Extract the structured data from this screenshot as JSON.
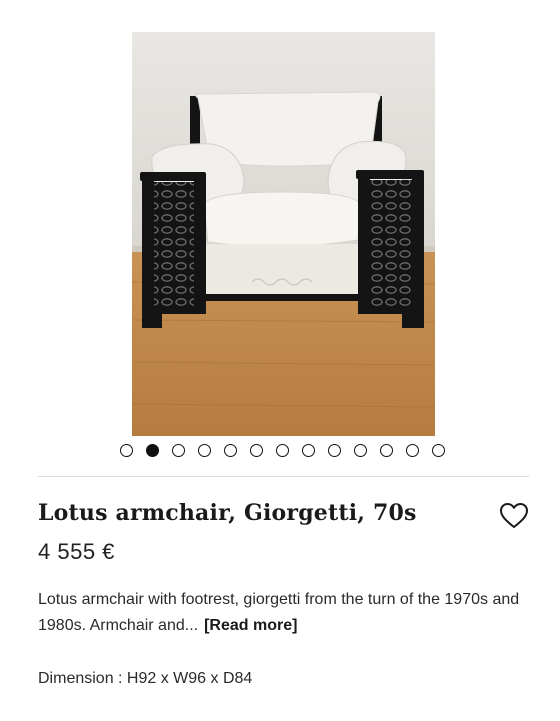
{
  "product": {
    "title": "Lotus armchair, Giorgetti, 70s",
    "price": "4 555 €",
    "description": "Lotus armchair with footrest, giorgetti from the turn of the 1970s and 1980s. Armchair and...",
    "read_more_label": "[Read more]",
    "dimension": "Dimension : H92 x W96 x D84"
  },
  "gallery": {
    "image_count": 13,
    "active_index": 2
  }
}
